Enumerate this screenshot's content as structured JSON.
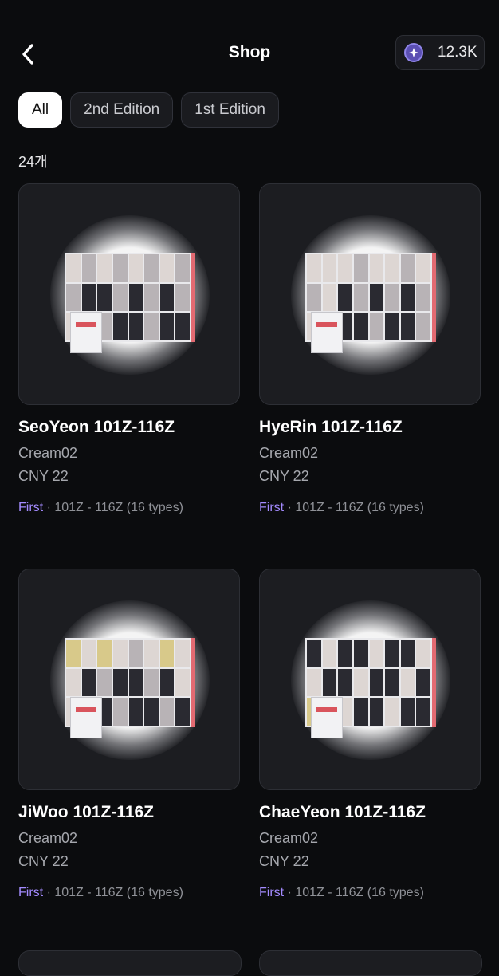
{
  "header": {
    "title": "Shop",
    "coins": "12.3K",
    "back_icon": "chevron-left-icon",
    "coin_icon": "sparkle-coin-icon",
    "accent": "#8f84e8"
  },
  "filters": [
    {
      "label": "All",
      "active": true
    },
    {
      "label": "2nd Edition",
      "active": false
    },
    {
      "label": "1st Edition",
      "active": false
    }
  ],
  "count_label": "24개",
  "products": [
    {
      "name": "SeoYeon 101Z-116Z",
      "vendor": "Cream02",
      "price": "CNY 22",
      "edition": "First",
      "detail": "101Z - 116Z (16 types)"
    },
    {
      "name": "HyeRin 101Z-116Z",
      "vendor": "Cream02",
      "price": "CNY 22",
      "edition": "First",
      "detail": "101Z - 116Z (16 types)"
    },
    {
      "name": "JiWoo 101Z-116Z",
      "vendor": "Cream02",
      "price": "CNY 22",
      "edition": "First",
      "detail": "101Z - 116Z (16 types)"
    },
    {
      "name": "ChaeYeon 101Z-116Z",
      "vendor": "Cream02",
      "price": "CNY 22",
      "edition": "First",
      "detail": "101Z - 116Z (16 types)"
    }
  ],
  "colors": {
    "background": "#0b0c0e",
    "card": "#1c1d21",
    "edition": "#a48bff"
  }
}
